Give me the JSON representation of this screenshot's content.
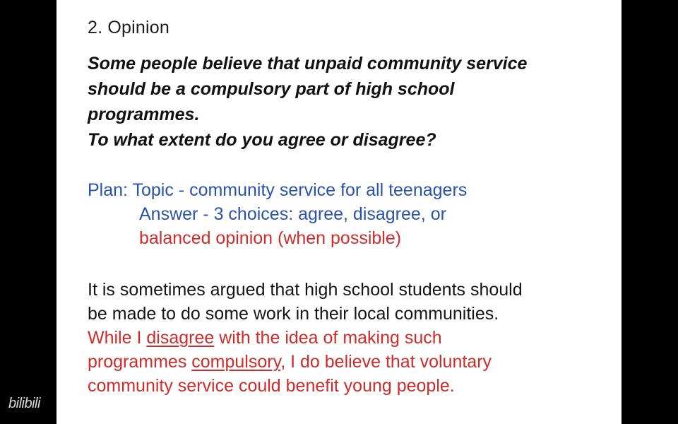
{
  "heading": "2. Opinion",
  "question": {
    "lines": [
      "Some people believe that unpaid community service",
      "should be a compulsory part of high school",
      "programmes.",
      "To what extent do you agree or disagree?"
    ]
  },
  "plan": {
    "label": "Plan:",
    "topic": "Topic - community service for all teenagers",
    "answer": "Answer - 3 choices: agree, disagree, or",
    "balanced": "balanced opinion (when possible)"
  },
  "paragraph": {
    "line1": "It is sometimes argued that high school students should",
    "line2": "be made to do some work in their local communities.",
    "line3_a": "While I ",
    "line3_u": "disagree",
    "line3_b": " with the idea of making such",
    "line4_a": "programmes ",
    "line4_u": "compulsory",
    "line4_b": ", I do believe that voluntary",
    "line5": "community service could benefit young people."
  },
  "watermark": "bilibili",
  "colors": {
    "blue_text": "#2a52b0",
    "red_text": "#d42a2a",
    "background": "#000000",
    "page": "#ffffff"
  }
}
